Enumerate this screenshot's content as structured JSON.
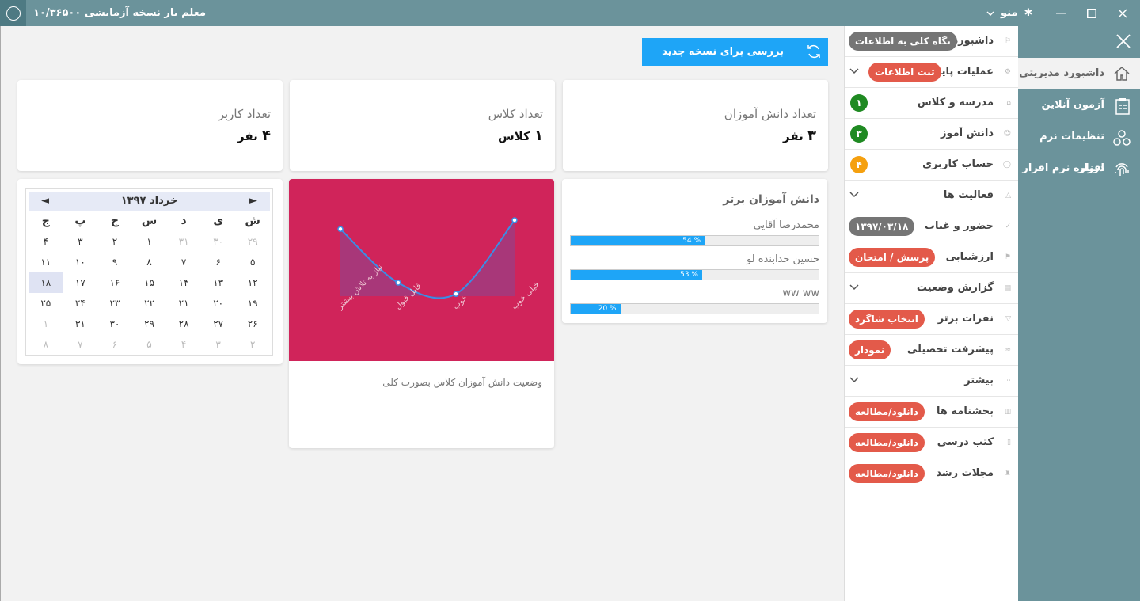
{
  "titlebar": {
    "title": "معلم یار نسخه آزمایشی ۱۰/۳۶۵۰۰",
    "menu_label": "منو"
  },
  "nav": {
    "items": [
      {
        "label": "داشبورد مدیریتی",
        "icon": "home-icon",
        "active": true
      },
      {
        "label": "آزمون آنلاین",
        "icon": "clipboard-icon"
      },
      {
        "label": "تنظیمات نرم افزار",
        "icon": "settings-cluster-icon"
      },
      {
        "label": "درباره نرم افزار",
        "icon": "fingerprint-icon"
      }
    ]
  },
  "menu": {
    "items": [
      {
        "label": "داشبورد",
        "badge": "نگاه کلی به اطلاعات",
        "badge_color": "gray"
      },
      {
        "label": "عملیات پایه",
        "badge": "ثبت اطلاعات",
        "badge_color": "red",
        "expand": true
      },
      {
        "label": "مدرسه و کلاس",
        "badge": "۱",
        "badge_color": "green",
        "circle": true
      },
      {
        "label": "دانش آموز",
        "badge": "۳",
        "badge_color": "green",
        "circle": true
      },
      {
        "label": "حساب کاربری",
        "badge": "۴",
        "badge_color": "orange",
        "circle": true
      },
      {
        "label": "فعالیت ها",
        "expand": true
      },
      {
        "label": "حضور و غیاب",
        "badge": "۱۳۹۷/۰۳/۱۸",
        "badge_color": "gray"
      },
      {
        "label": "ارزشیابی",
        "badge": "پرسش / امتحان",
        "badge_color": "red"
      },
      {
        "label": "گزارش وضعیت",
        "expand": true
      },
      {
        "label": "نفرات برتر",
        "badge": "انتخاب شاگرد",
        "badge_color": "red"
      },
      {
        "label": "پیشرفت تحصیلی",
        "badge": "نمودار",
        "badge_color": "red"
      },
      {
        "label": "بیشتر",
        "expand": true
      },
      {
        "label": "بخشنامه ها",
        "badge": "دانلود/مطالعه",
        "badge_color": "red"
      },
      {
        "label": "کتب درسی",
        "badge": "دانلود/مطالعه",
        "badge_color": "red"
      },
      {
        "label": "مجلات رشد",
        "badge": "دانلود/مطالعه",
        "badge_color": "red"
      }
    ]
  },
  "update_button": "بررسی برای نسخه جدید",
  "stats": [
    {
      "title": "تعداد دانش آموزان",
      "value": "۳",
      "unit": "نفر"
    },
    {
      "title": "تعداد کلاس",
      "value": "۱",
      "unit": "کلاس"
    },
    {
      "title": "تعداد کاربر",
      "value": "۴",
      "unit": "نفر"
    }
  ],
  "top_students": {
    "title": "دانش آموزان برتر",
    "rows": [
      {
        "name": "محمدرضا آقایی",
        "percent": 54,
        "label": "54 %"
      },
      {
        "name": "حسین خدابنده لو",
        "percent": 53,
        "label": "53 %"
      },
      {
        "name": "ww ww",
        "percent": 20,
        "label": "20 %"
      }
    ]
  },
  "chart_caption": "وضعیت دانش آموزان کلاس بصورت کلی",
  "chart_data": {
    "type": "area",
    "categories": [
      "نیاز به تلاش بیشتر",
      "قابل قبول",
      "خوب",
      "خیلی خوب"
    ],
    "values": [
      4,
      1.6,
      1.1,
      4.4
    ],
    "ylim": [
      0,
      5
    ],
    "grid": false,
    "color": "#d0245a"
  },
  "calendar": {
    "title": "خرداد ۱۳۹۷",
    "prev": "◄",
    "next": "►",
    "weekdays": [
      "ش",
      "ی",
      "د",
      "س",
      "چ",
      "پ",
      "ج"
    ],
    "days": [
      {
        "d": "۲۹",
        "m": true
      },
      {
        "d": "۳۰",
        "m": true
      },
      {
        "d": "۳۱",
        "m": true
      },
      {
        "d": "۱"
      },
      {
        "d": "۲"
      },
      {
        "d": "۳"
      },
      {
        "d": "۴"
      },
      {
        "d": "۵"
      },
      {
        "d": "۶"
      },
      {
        "d": "۷"
      },
      {
        "d": "۸"
      },
      {
        "d": "۹"
      },
      {
        "d": "۱۰"
      },
      {
        "d": "۱۱"
      },
      {
        "d": "۱۲"
      },
      {
        "d": "۱۳"
      },
      {
        "d": "۱۴"
      },
      {
        "d": "۱۵"
      },
      {
        "d": "۱۶"
      },
      {
        "d": "۱۷"
      },
      {
        "d": "۱۸",
        "sel": true
      },
      {
        "d": "۱۹"
      },
      {
        "d": "۲۰"
      },
      {
        "d": "۲۱"
      },
      {
        "d": "۲۲"
      },
      {
        "d": "۲۳"
      },
      {
        "d": "۲۴"
      },
      {
        "d": "۲۵"
      },
      {
        "d": "۲۶"
      },
      {
        "d": "۲۷"
      },
      {
        "d": "۲۸"
      },
      {
        "d": "۲۹"
      },
      {
        "d": "۳۰"
      },
      {
        "d": "۳۱"
      },
      {
        "d": "۱",
        "m": true
      },
      {
        "d": "۲",
        "m": true
      },
      {
        "d": "۳",
        "m": true
      },
      {
        "d": "۴",
        "m": true
      },
      {
        "d": "۵",
        "m": true
      },
      {
        "d": "۶",
        "m": true
      },
      {
        "d": "۷",
        "m": true
      },
      {
        "d": "۸",
        "m": true
      }
    ]
  }
}
